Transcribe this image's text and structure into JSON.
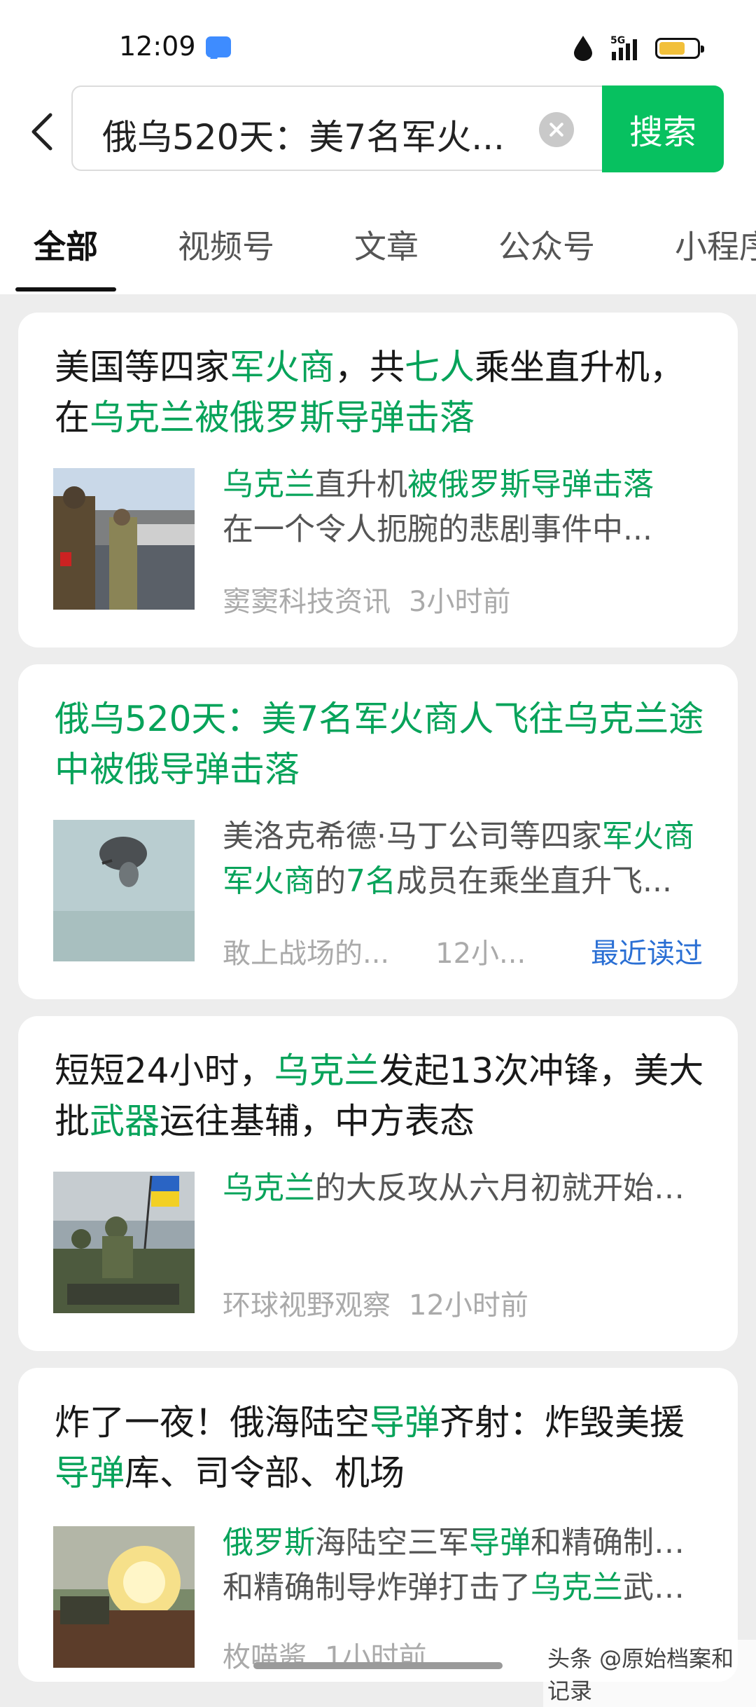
{
  "status_bar": {
    "time": "12:09",
    "network": "5G"
  },
  "search": {
    "query": "俄乌520天：美7名军火...",
    "button_label": "搜索"
  },
  "tabs": [
    "全部",
    "视频号",
    "文章",
    "公众号",
    "小程序"
  ],
  "results": [
    {
      "title": [
        "美国等四家",
        "军火商",
        "，共",
        "七人",
        "乘坐直升机，在",
        "乌克兰被俄罗斯导弹击落"
      ],
      "snippet": [
        "乌克兰",
        "直升机",
        "被俄罗斯导弹击落",
        "在一个令人扼腕的悲剧事件中..."
      ],
      "source": "窦窦科技资讯",
      "time": "3小时前"
    },
    {
      "title": [
        "俄乌520天：美7名军火商人飞往乌克兰途中被俄导弹击落"
      ],
      "snippet": [
        "美洛克希德·马丁公司等四家",
        "军火商",
        "的",
        "7名",
        "成员在乘坐直升飞..."
      ],
      "source": "敢上战场的...",
      "time": "12小...",
      "badge": "最近读过"
    },
    {
      "title": [
        "短短24小时，",
        "乌克兰",
        "发起13次冲锋，美大批",
        "武器",
        "运往基辅，中方表态"
      ],
      "snippet": [
        "乌克兰",
        "的大反攻从六月初就开始了，一直持续到现在可谓是效..."
      ],
      "source": "环球视野观察",
      "time": "12小时前"
    },
    {
      "title": [
        "炸了一夜！俄海陆空",
        "导弹",
        "齐射：炸毁美援",
        "导弹",
        "库、司令部、机场"
      ],
      "snippet": [
        "俄罗斯",
        "海陆空三军",
        "导弹",
        "和精确制导炸弹打击了",
        "乌克兰",
        "武装部队..."
      ],
      "source": "枚喵酱",
      "time": "1小时前"
    }
  ],
  "watermark": "头条 @原始档案和记录",
  "colors": {
    "accent": "#07c160",
    "highlight": "#07a35a",
    "link": "#2a6fd4"
  }
}
